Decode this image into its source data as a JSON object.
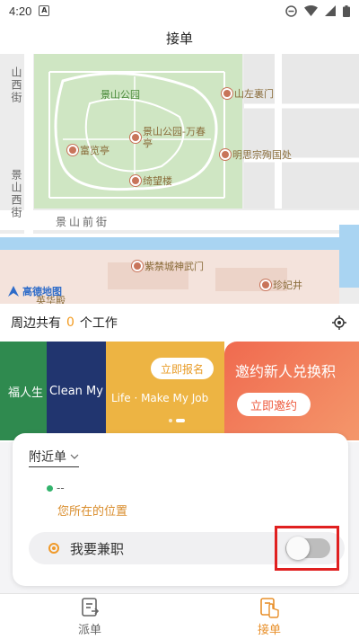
{
  "status_bar": {
    "time": "4:20"
  },
  "title": "接单",
  "map": {
    "pois": [
      "景山公园",
      "山左裏门",
      "富览亭",
      "景山公园-万春亭",
      "明思宗殉国处",
      "绮望楼",
      "紫禁城神武门",
      "珍妃井",
      "英华殿"
    ],
    "streets": [
      "景山前街"
    ],
    "vertical_streets": [
      "山西街",
      "景山西街"
    ],
    "logo": "高德地图"
  },
  "nearby": {
    "prefix": "周边共有",
    "count": "0",
    "suffix": "个工作"
  },
  "banner": {
    "slide1": "福人生",
    "slide2": "Clean My",
    "slide3_cta": "立即报名",
    "slide3_text": "Life · Make My Job",
    "slide4_title": "邀约新人兑换积",
    "slide4_cta": "立即邀约"
  },
  "card": {
    "filter_label": "附近单",
    "location_value": "--",
    "location_label": "您所在的位置",
    "parttime_label": "我要兼职",
    "parttime_enabled": false
  },
  "tabs": [
    {
      "label": "派单",
      "active": false
    },
    {
      "label": "接单",
      "active": true
    }
  ],
  "colors": {
    "accent": "#e8902b",
    "highlight": "#e02020"
  }
}
